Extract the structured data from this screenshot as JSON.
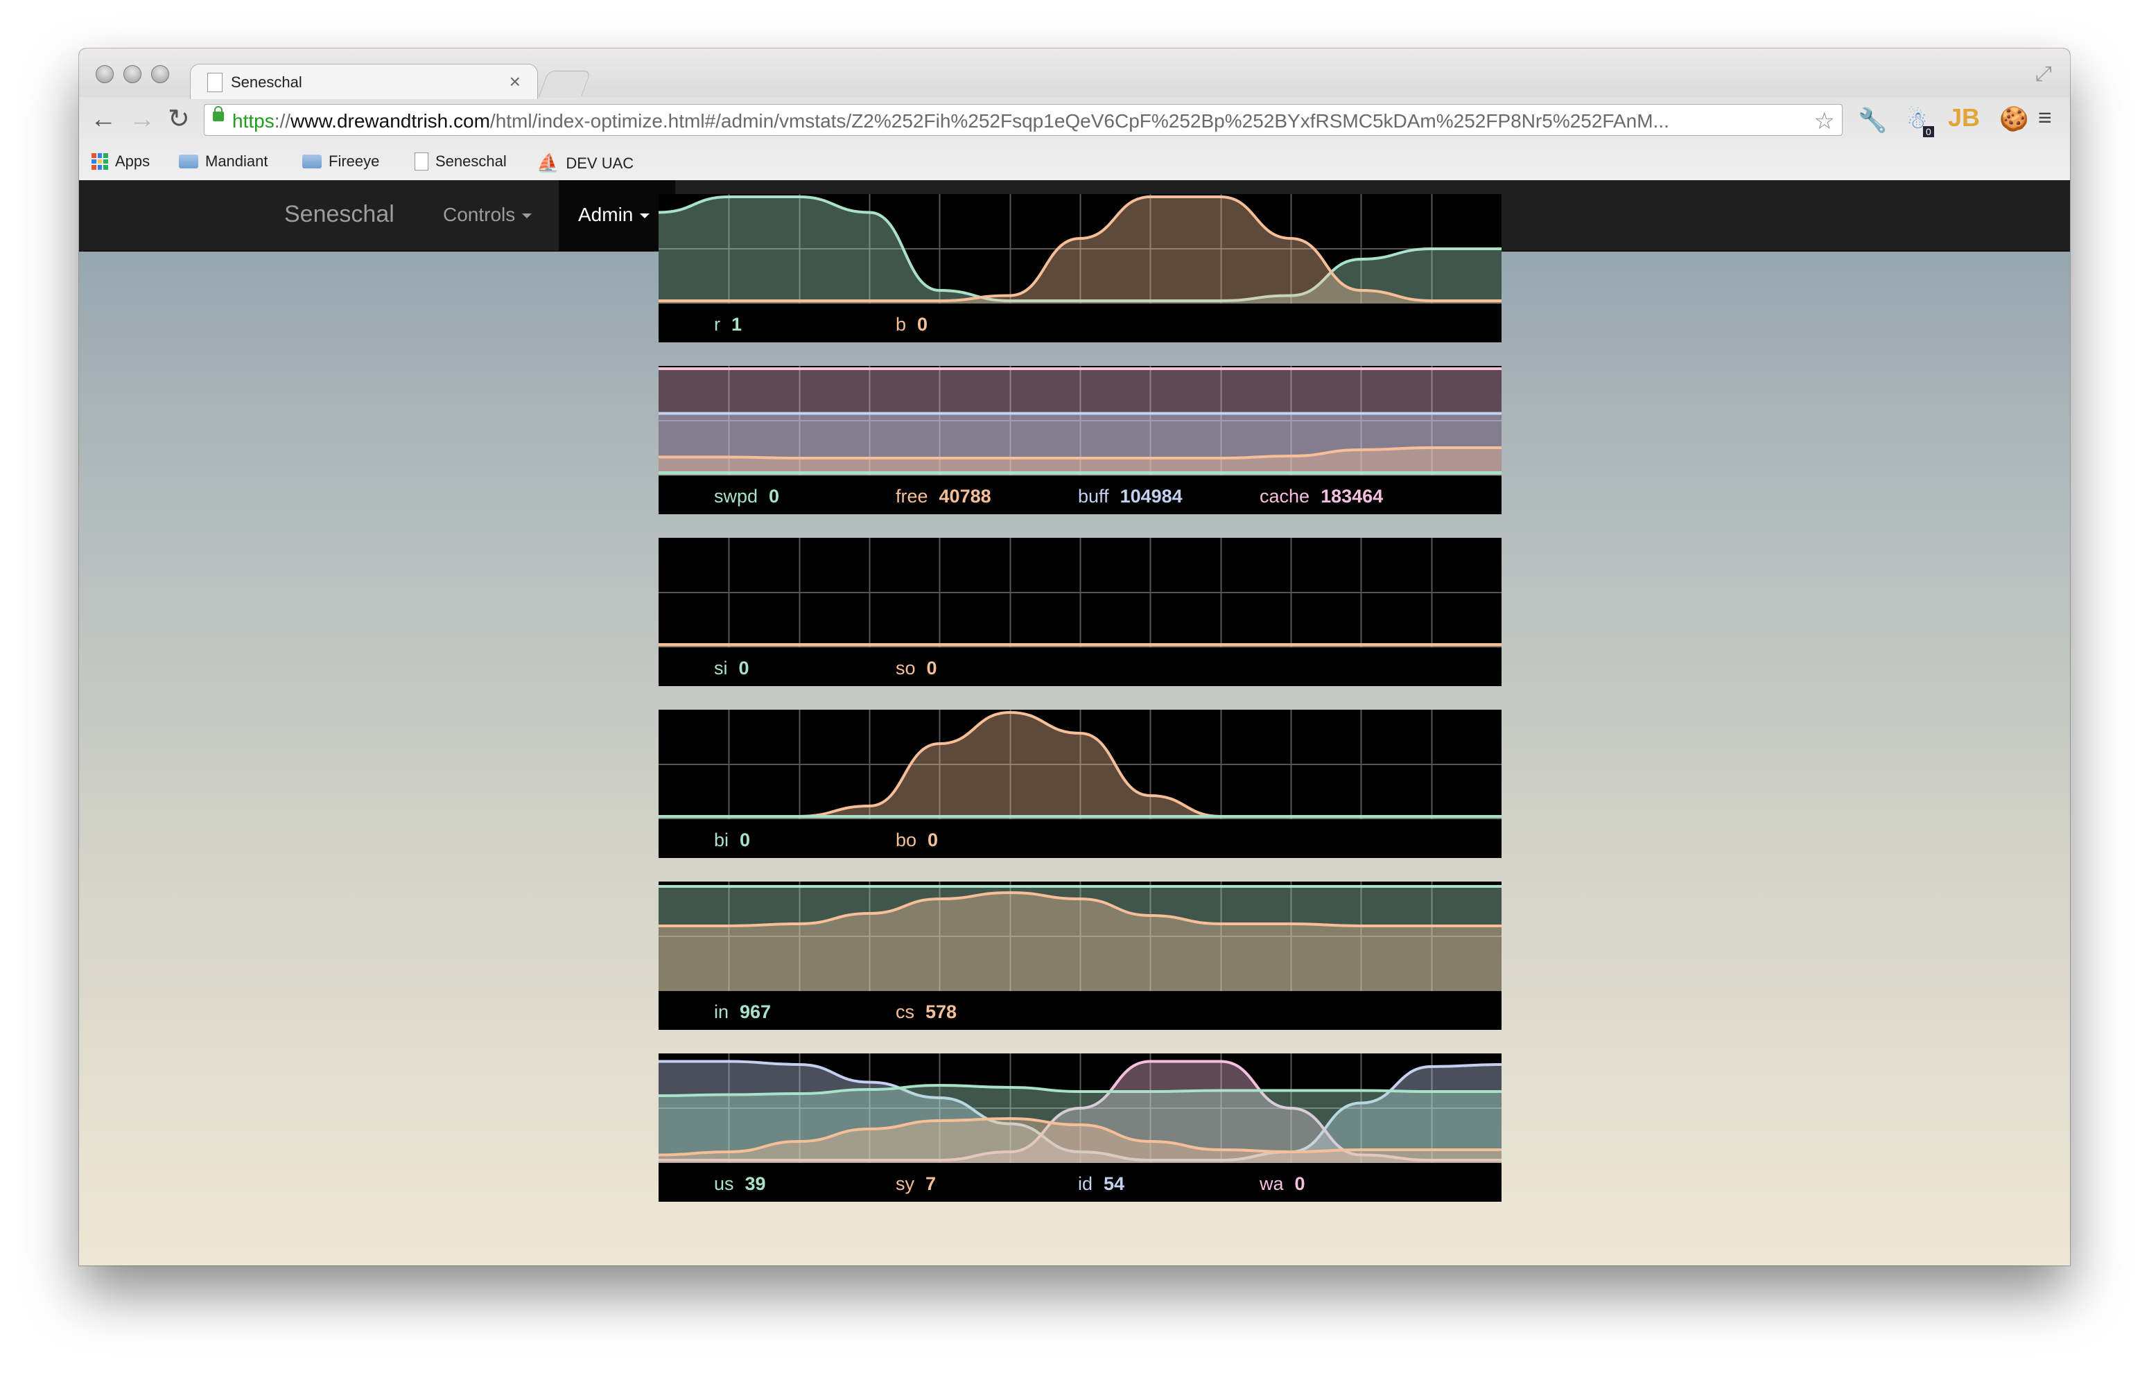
{
  "browser": {
    "tab_title": "Seneschal",
    "tab_close": "×",
    "url_scheme": "https",
    "url_sep": "://",
    "url_host": "www.drewandtrish.com",
    "url_path": "/html/index-optimize.html#/admin/vmstats/Z2%252Fih%252Fsqp1eQeV6CpF%252Bp%252BYxfRSMC5kDAm%252FP8Nr5%252FAnM...",
    "bookmarks": [
      "Apps",
      "Mandiant",
      "Fireeye",
      "Seneschal",
      "DEV UAC"
    ],
    "ext_badge": "0",
    "ext_jb": "JB"
  },
  "navbar": {
    "brand": "Seneschal",
    "controls": "Controls",
    "admin": "Admin"
  },
  "colors": {
    "green": "#a8e2c8",
    "orange": "#f6bf98",
    "blue": "#c3d0ef",
    "pink": "#f6bfe0"
  },
  "panels": [
    {
      "legend": [
        {
          "label": "r",
          "value": "1",
          "color": "green"
        },
        {
          "label": "b",
          "value": "0",
          "color": "orange"
        }
      ]
    },
    {
      "legend": [
        {
          "label": "swpd",
          "value": "0",
          "color": "green"
        },
        {
          "label": "free",
          "value": "40788",
          "color": "orange"
        },
        {
          "label": "buff",
          "value": "104984",
          "color": "blue"
        },
        {
          "label": "cache",
          "value": "183464",
          "color": "pink"
        }
      ]
    },
    {
      "legend": [
        {
          "label": "si",
          "value": "0",
          "color": "green"
        },
        {
          "label": "so",
          "value": "0",
          "color": "orange"
        }
      ]
    },
    {
      "legend": [
        {
          "label": "bi",
          "value": "0",
          "color": "green"
        },
        {
          "label": "bo",
          "value": "0",
          "color": "orange"
        }
      ]
    },
    {
      "legend": [
        {
          "label": "in",
          "value": "967",
          "color": "green"
        },
        {
          "label": "cs",
          "value": "578",
          "color": "orange"
        }
      ]
    },
    {
      "legend": [
        {
          "label": "us",
          "value": "39",
          "color": "green"
        },
        {
          "label": "sy",
          "value": "7",
          "color": "orange"
        },
        {
          "label": "id",
          "value": "54",
          "color": "blue"
        },
        {
          "label": "wa",
          "value": "0",
          "color": "pink"
        }
      ]
    }
  ],
  "chart_data": [
    {
      "type": "area",
      "x": [
        0,
        1,
        2,
        3,
        4,
        5,
        6,
        7,
        8,
        9,
        10,
        11,
        12
      ],
      "series": [
        {
          "name": "r",
          "values": [
            0.85,
            1,
            1,
            0.85,
            0.1,
            0,
            0,
            0,
            0,
            0.05,
            0.4,
            0.5,
            0.5
          ]
        },
        {
          "name": "b",
          "values": [
            0,
            0,
            0,
            0,
            0,
            0.05,
            0.6,
            1,
            1,
            0.6,
            0.1,
            0,
            0
          ]
        }
      ]
    },
    {
      "type": "area",
      "x": [
        0,
        1,
        2,
        3,
        4,
        5,
        6,
        7,
        8,
        9,
        10,
        11,
        12
      ],
      "series": [
        {
          "name": "swpd",
          "values": [
            0,
            0,
            0,
            0,
            0,
            0,
            0,
            0,
            0,
            0,
            0,
            0,
            0
          ]
        },
        {
          "name": "free",
          "values": [
            0.15,
            0.15,
            0.14,
            0.14,
            0.14,
            0.14,
            0.14,
            0.14,
            0.14,
            0.16,
            0.22,
            0.24,
            0.24
          ]
        },
        {
          "name": "buff",
          "values": [
            0.57,
            0.57,
            0.57,
            0.57,
            0.57,
            0.57,
            0.57,
            0.57,
            0.57,
            0.57,
            0.57,
            0.57,
            0.57
          ]
        },
        {
          "name": "cache",
          "values": [
            1,
            1,
            1,
            1,
            1,
            1,
            1,
            1,
            1,
            1,
            1,
            1,
            1
          ]
        }
      ]
    },
    {
      "type": "area",
      "x": [
        0,
        1,
        2,
        3,
        4,
        5,
        6,
        7,
        8,
        9,
        10,
        11,
        12
      ],
      "series": [
        {
          "name": "si",
          "values": [
            0,
            0,
            0,
            0,
            0,
            0,
            0,
            0,
            0,
            0,
            0,
            0,
            0
          ]
        },
        {
          "name": "so",
          "values": [
            0,
            0,
            0,
            0,
            0,
            0,
            0,
            0,
            0,
            0,
            0,
            0,
            0
          ]
        }
      ]
    },
    {
      "type": "area",
      "x": [
        0,
        1,
        2,
        3,
        4,
        5,
        6,
        7,
        8,
        9,
        10,
        11,
        12
      ],
      "series": [
        {
          "name": "bi",
          "values": [
            0,
            0,
            0,
            0,
            0,
            0,
            0,
            0,
            0,
            0,
            0,
            0,
            0
          ]
        },
        {
          "name": "bo",
          "values": [
            0,
            0,
            0,
            0.1,
            0.7,
            1,
            0.8,
            0.2,
            0,
            0,
            0,
            0,
            0
          ]
        }
      ]
    },
    {
      "type": "area",
      "x": [
        0,
        1,
        2,
        3,
        4,
        5,
        6,
        7,
        8,
        9,
        10,
        11,
        12
      ],
      "series": [
        {
          "name": "in",
          "values": [
            0.98,
            0.98,
            0.98,
            0.98,
            0.98,
            0.98,
            0.98,
            0.98,
            0.98,
            0.98,
            0.98,
            0.98,
            0.98
          ]
        },
        {
          "name": "cs",
          "values": [
            0.6,
            0.6,
            0.62,
            0.72,
            0.86,
            0.92,
            0.86,
            0.7,
            0.62,
            0.62,
            0.6,
            0.6,
            0.6
          ]
        }
      ]
    },
    {
      "type": "area",
      "x": [
        0,
        1,
        2,
        3,
        4,
        5,
        6,
        7,
        8,
        9,
        10,
        11,
        12
      ],
      "series": [
        {
          "name": "us",
          "values": [
            0.62,
            0.63,
            0.64,
            0.68,
            0.72,
            0.7,
            0.66,
            0.66,
            0.67,
            0.67,
            0.67,
            0.66,
            0.66
          ]
        },
        {
          "name": "sy",
          "values": [
            0.05,
            0.08,
            0.18,
            0.3,
            0.38,
            0.4,
            0.34,
            0.18,
            0.1,
            0.08,
            0.1,
            0.1,
            0.1
          ]
        },
        {
          "name": "id",
          "values": [
            0.95,
            0.95,
            0.92,
            0.75,
            0.6,
            0.35,
            0.08,
            0,
            0,
            0.08,
            0.55,
            0.9,
            0.92
          ]
        },
        {
          "name": "wa",
          "values": [
            0,
            0,
            0,
            0,
            0,
            0.08,
            0.5,
            0.95,
            0.95,
            0.5,
            0.05,
            0,
            0
          ]
        }
      ]
    }
  ]
}
